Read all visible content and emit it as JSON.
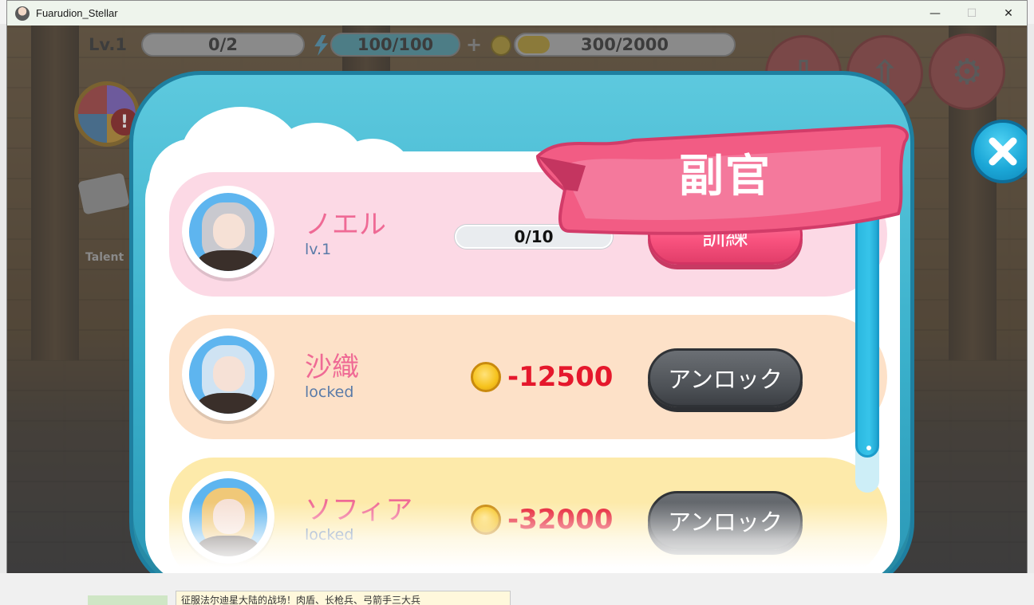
{
  "window": {
    "title": "Fuarudion_Stellar",
    "minimize": "—",
    "maximize": "☐",
    "close": "✕"
  },
  "hud": {
    "level": "Lv.1",
    "exp": "0/2",
    "energy": "100/100",
    "gold": "300/2000",
    "talent_label": "Talent"
  },
  "dialog": {
    "title": "副官",
    "close_icon": "close-icon",
    "colors": {
      "frame": "#3ab0cb",
      "banner": "#f4708f",
      "row_pink": "#fcd9e5",
      "row_peach": "#fde1c8",
      "row_yellow": "#fdeaaa"
    }
  },
  "adjutants": [
    {
      "name": "ノエル",
      "sub": "lv.1",
      "progress": "0/10",
      "button": "訓練",
      "hair": "#c9c9cf"
    },
    {
      "name": "沙織",
      "sub": "locked",
      "cost": "-12500",
      "button": "アンロック",
      "hair": "#cfe3f3"
    },
    {
      "name": "ソフィア",
      "sub": "locked",
      "cost": "-32000",
      "button": "アンロック",
      "hair": "#f0c878"
    }
  ],
  "desktop": {
    "bottom_text": "征服法尔迪星大陆的战场！肉盾、长枪兵、弓箭手三大兵"
  }
}
